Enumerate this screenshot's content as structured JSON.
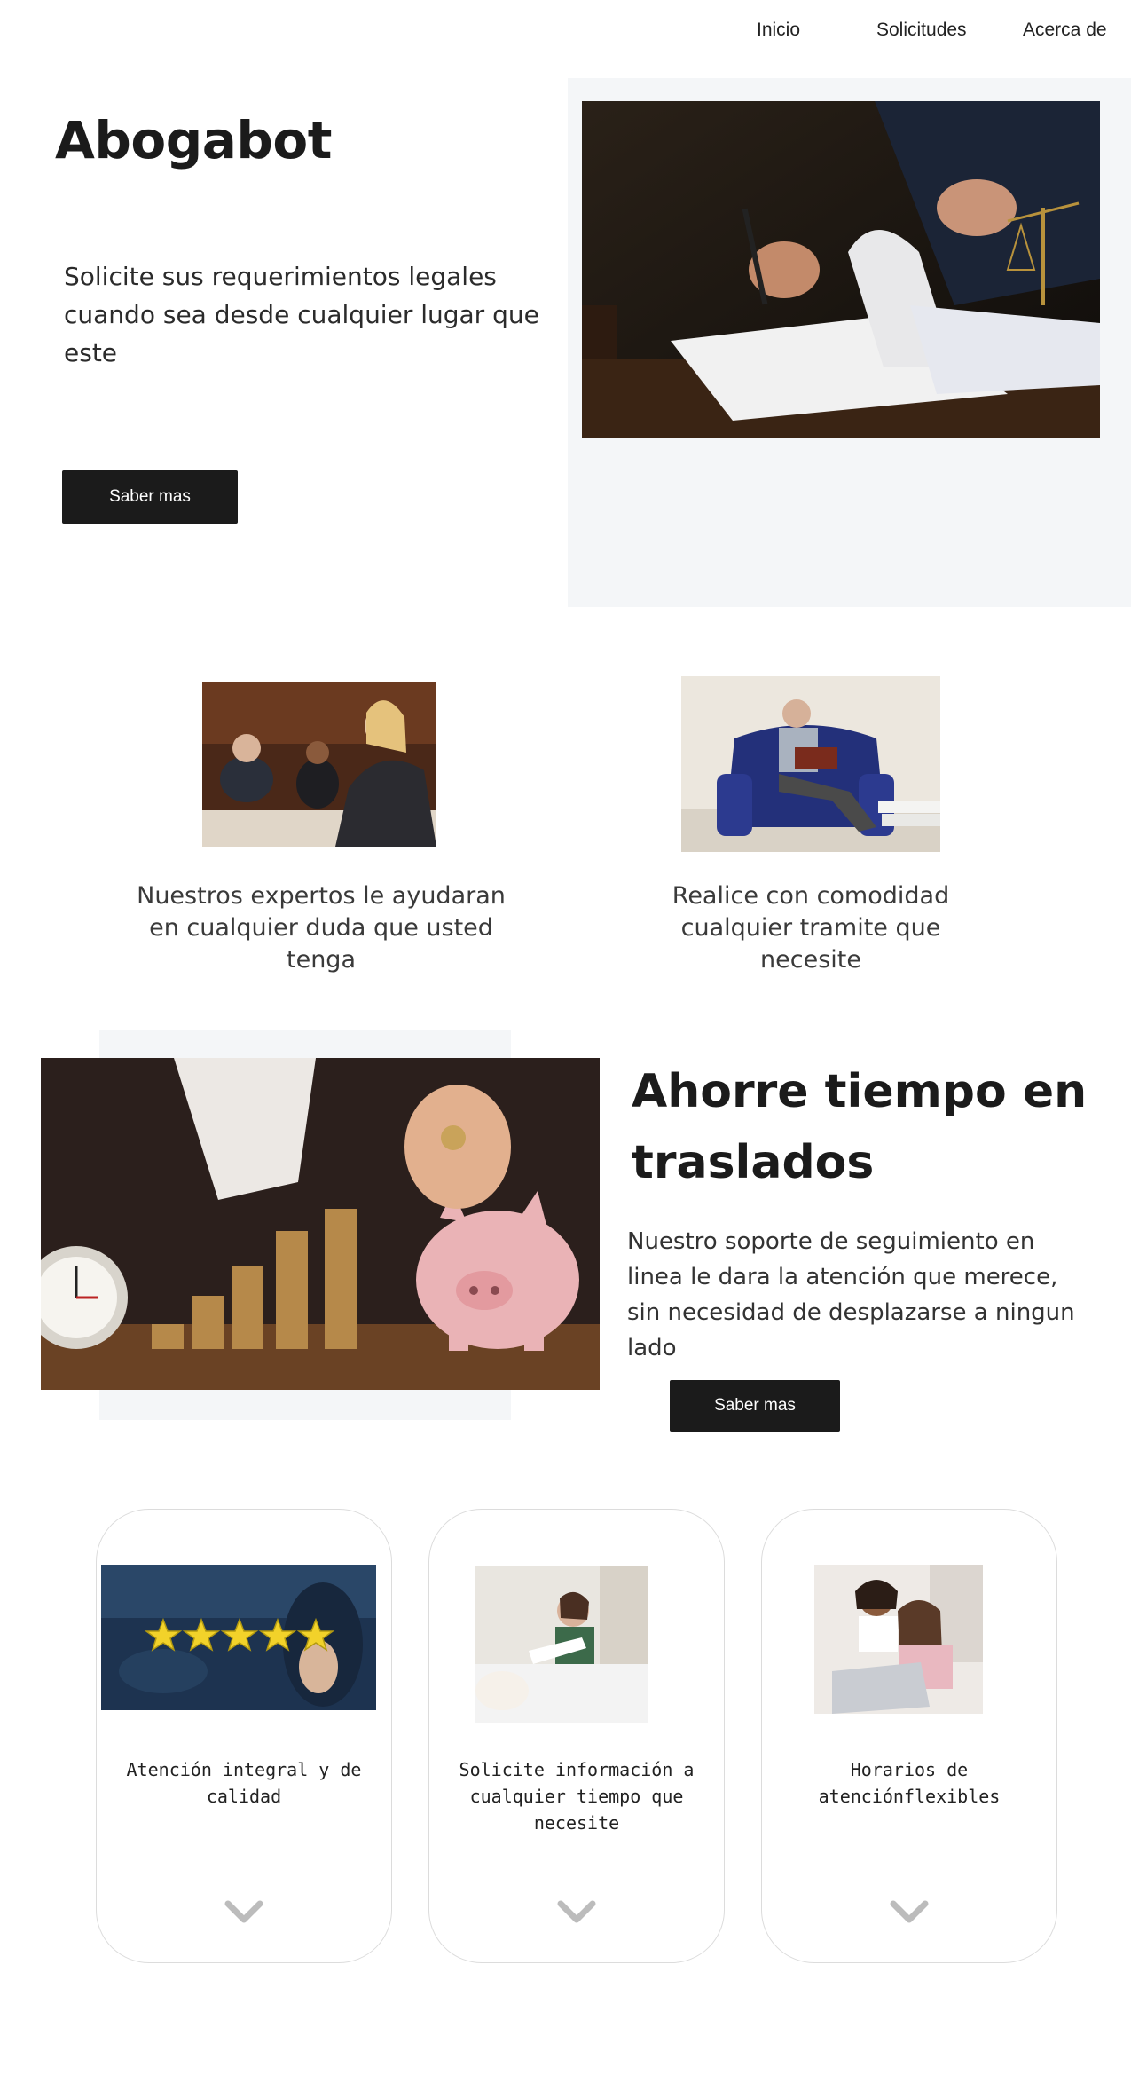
{
  "nav": {
    "items": [
      {
        "label": "Inicio"
      },
      {
        "label": "Solicitudes"
      },
      {
        "label": "Acerca de"
      }
    ]
  },
  "hero": {
    "title": "Abogabot",
    "subtitle": "Solicite sus requerimientos legales cuando sea desde cualquier lugar que este",
    "button_label": "Saber mas"
  },
  "features": [
    {
      "text": "Nuestros expertos le ayudaran en cualquier duda que usted tenga"
    },
    {
      "text": "Realice con comodidad cualquier tramite que necesite"
    }
  ],
  "savings": {
    "title": "Ahorre tiempo en traslados",
    "text": "Nuestro soporte de seguimiento en linea le dara la atención que merece, sin necesidad de desplazarse a ningun lado",
    "button_label": "Saber mas"
  },
  "cards": [
    {
      "text": "Atención integral y de calidad",
      "icon": "chevron-down-icon"
    },
    {
      "text": "Solicite información a cualquier tiempo que necesite",
      "icon": "chevron-down-icon"
    },
    {
      "text": "Horarios de atenciónflexibles",
      "icon": "chevron-down-icon"
    }
  ],
  "colors": {
    "button_bg": "#1b1b1b",
    "panel_bg": "#f4f6f8",
    "text": "#1b1b1b"
  }
}
